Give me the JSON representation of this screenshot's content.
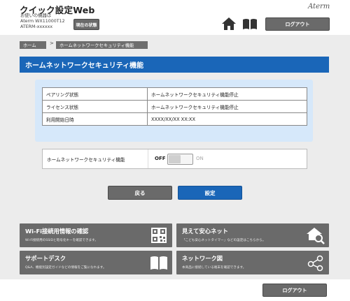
{
  "header": {
    "app_title": "クイック設定Web",
    "device_line1": "お使いの機器は",
    "device_line2": "Aterm WX11000T12",
    "device_line3": "ATERM-xxxxxx",
    "status_button": "現在の状態",
    "brand": "Aterm",
    "logout": "ログアウト",
    "home_icon": "home-icon",
    "manual_icon": "book-icon"
  },
  "breadcrumb": {
    "home": "ホーム",
    "separator": ">",
    "current": "ホームネットワークセキュリティ機能"
  },
  "page_title": "ホームネットワークセキュリティ機能",
  "info_table": {
    "rows": [
      {
        "label": "ペアリング状態",
        "value": "ホームネットワークセキュリティ機能停止"
      },
      {
        "label": "ライセンス状態",
        "value": "ホームネットワークセキュリティ機能停止"
      },
      {
        "label": "利用開始日時",
        "value": "XXXX/XX/XX XX:XX"
      }
    ]
  },
  "setting": {
    "label": "ホームネットワークセキュリティ機能",
    "off_label": "OFF",
    "on_label": "ON",
    "state": "off"
  },
  "buttons": {
    "back": "戻る",
    "save": "設定"
  },
  "cards": [
    {
      "title": "Wi-Fi接続用情報の確認",
      "desc": "Wi-Fi接続用のSSIDと暗号化キーを確認できます。",
      "icon": "qr-code-icon"
    },
    {
      "title": "見えて安心ネット",
      "desc": "「こども安心ネットタイマー」などの設定はこちらから。",
      "icon": "home-search-icon"
    },
    {
      "title": "サポートデスク",
      "desc": "Q&A、機能別設定ガイドなどの情報をご覧になれます。",
      "icon": "open-book-icon"
    },
    {
      "title": "ネットワーク図",
      "desc": "本商品に接続している端末を確認できます。",
      "icon": "network-icon"
    }
  ],
  "footer": {
    "logout": "ログアウト"
  },
  "colors": {
    "primary_blue": "#1a66b8",
    "panel_blue": "#d6e8fa",
    "button_gray": "#6a6a6a"
  }
}
